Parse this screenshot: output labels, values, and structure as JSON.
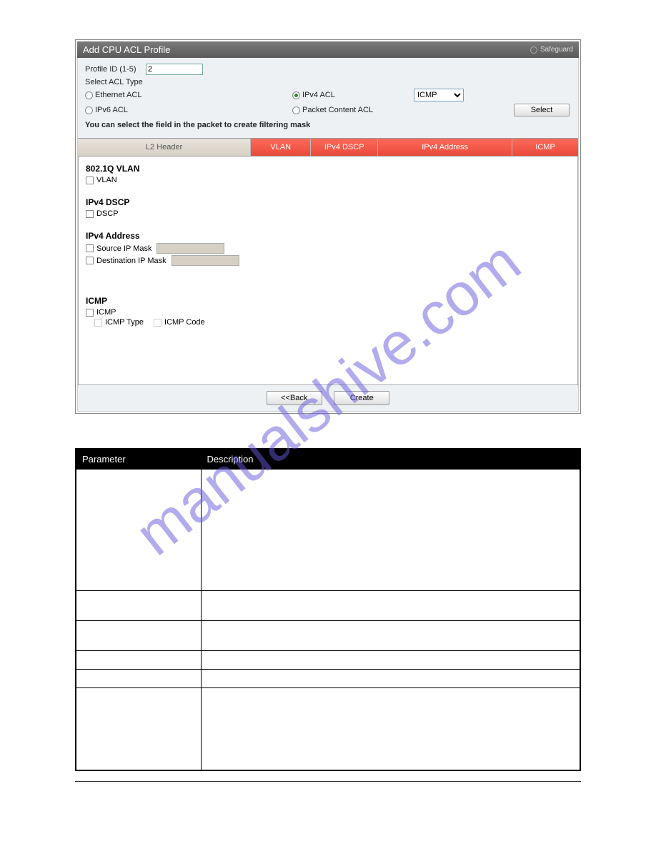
{
  "panel": {
    "title": "Add CPU ACL Profile",
    "safeguard": "Safeguard"
  },
  "form": {
    "profile_id_label": "Profile ID (1-5)",
    "profile_id_value": "2",
    "select_acl_type_label": "Select ACL Type",
    "ethernet_acl": "Ethernet ACL",
    "ipv6_acl": "IPv6 ACL",
    "ipv4_acl": "IPv4 ACL",
    "packet_content_acl": "Packet Content ACL",
    "protocol_selected": "ICMP",
    "select_button": "Select",
    "mask_note": "You can select the field in the packet to create filtering mask"
  },
  "tabs": {
    "l2": "L2 Header",
    "vlan": "VLAN",
    "dscp": "IPv4 DSCP",
    "addr": "IPv4 Address",
    "icmp": "ICMP"
  },
  "sections": {
    "vlan_title": "802.1Q VLAN",
    "vlan_chk": "VLAN",
    "dscp_title": "IPv4 DSCP",
    "dscp_chk": "DSCP",
    "addr_title": "IPv4 Address",
    "src_ip_mask": "Source IP Mask",
    "dst_ip_mask": "Destination IP Mask",
    "icmp_title": "ICMP",
    "icmp_chk": "ICMP",
    "icmp_type": "ICMP Type",
    "icmp_code": "ICMP Code"
  },
  "footer": {
    "back": "<<Back",
    "create": "Create"
  },
  "table": {
    "hdr_param": "Parameter",
    "hdr_desc": "Description"
  },
  "watermark": "manualshive.com"
}
